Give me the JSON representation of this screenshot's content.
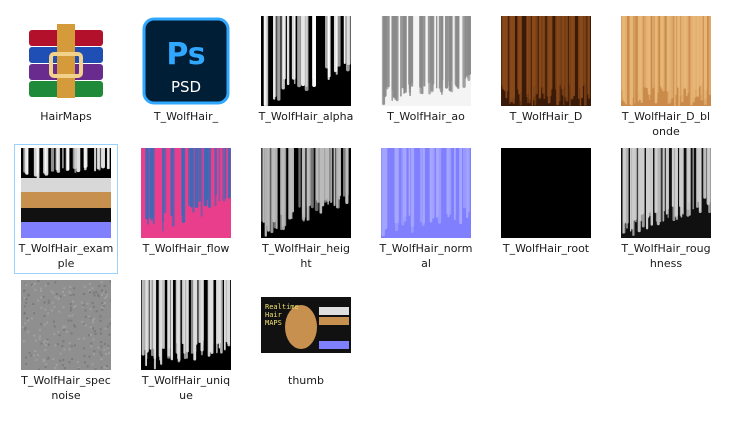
{
  "files": [
    {
      "name": "HairMaps",
      "label_lines": [
        "HairMaps"
      ],
      "thumb": "winrar-icon",
      "selected": false
    },
    {
      "name": "T_WolfHair_",
      "label_lines": [
        "T_WolfHair_"
      ],
      "thumb": "photoshop-psd-icon",
      "badge": "Ps",
      "subtext": "PSD",
      "selected": false
    },
    {
      "name": "T_WolfHair_alpha",
      "label_lines": [
        "T_WolfHair_alpha"
      ],
      "thumb": "alpha",
      "selected": false
    },
    {
      "name": "T_WolfHair_ao",
      "label_lines": [
        "T_WolfHair_ao"
      ],
      "thumb": "ao",
      "selected": false
    },
    {
      "name": "T_WolfHair_D",
      "label_lines": [
        "T_WolfHair_D"
      ],
      "thumb": "diffuse",
      "selected": false
    },
    {
      "name": "T_WolfHair_D_blonde",
      "label_lines": [
        "T_WolfHair_D_bl",
        "onde"
      ],
      "thumb": "blonde",
      "selected": false
    },
    {
      "name": "T_WolfHair_example",
      "label_lines": [
        "T_WolfHair_exam",
        "ple"
      ],
      "thumb": "example",
      "selected": true
    },
    {
      "name": "T_WolfHair_flow",
      "label_lines": [
        "T_WolfHair_flow"
      ],
      "thumb": "flow",
      "selected": false
    },
    {
      "name": "T_WolfHair_height",
      "label_lines": [
        "T_WolfHair_heig",
        "ht"
      ],
      "thumb": "height",
      "selected": false
    },
    {
      "name": "T_WolfHair_normal",
      "label_lines": [
        "T_WolfHair_norm",
        "al"
      ],
      "thumb": "normal",
      "selected": false
    },
    {
      "name": "T_WolfHair_root",
      "label_lines": [
        "T_WolfHair_root"
      ],
      "thumb": "root",
      "selected": false
    },
    {
      "name": "T_WolfHair_roughness",
      "label_lines": [
        "T_WolfHair_roug",
        "hness"
      ],
      "thumb": "roughness",
      "selected": false
    },
    {
      "name": "T_WolfHair_specnoise",
      "label_lines": [
        "T_WolfHair_spec",
        "noise"
      ],
      "thumb": "specnoise",
      "selected": false
    },
    {
      "name": "T_WolfHair_unique",
      "label_lines": [
        "T_WolfHair_uniq",
        "ue"
      ],
      "thumb": "unique",
      "selected": false
    },
    {
      "name": "thumb",
      "label_lines": [
        "thumb"
      ],
      "thumb": "thumb-preview",
      "thumb_text": [
        "Realtime",
        "Hair",
        "MAPS"
      ],
      "selected": false
    }
  ],
  "colors": {
    "selection_border": "#99d1ff",
    "psd_bg": "#001e36",
    "psd_blue": "#31a8ff",
    "normal_blue": "#8080ff",
    "flow_pink": "#e83e8c"
  }
}
